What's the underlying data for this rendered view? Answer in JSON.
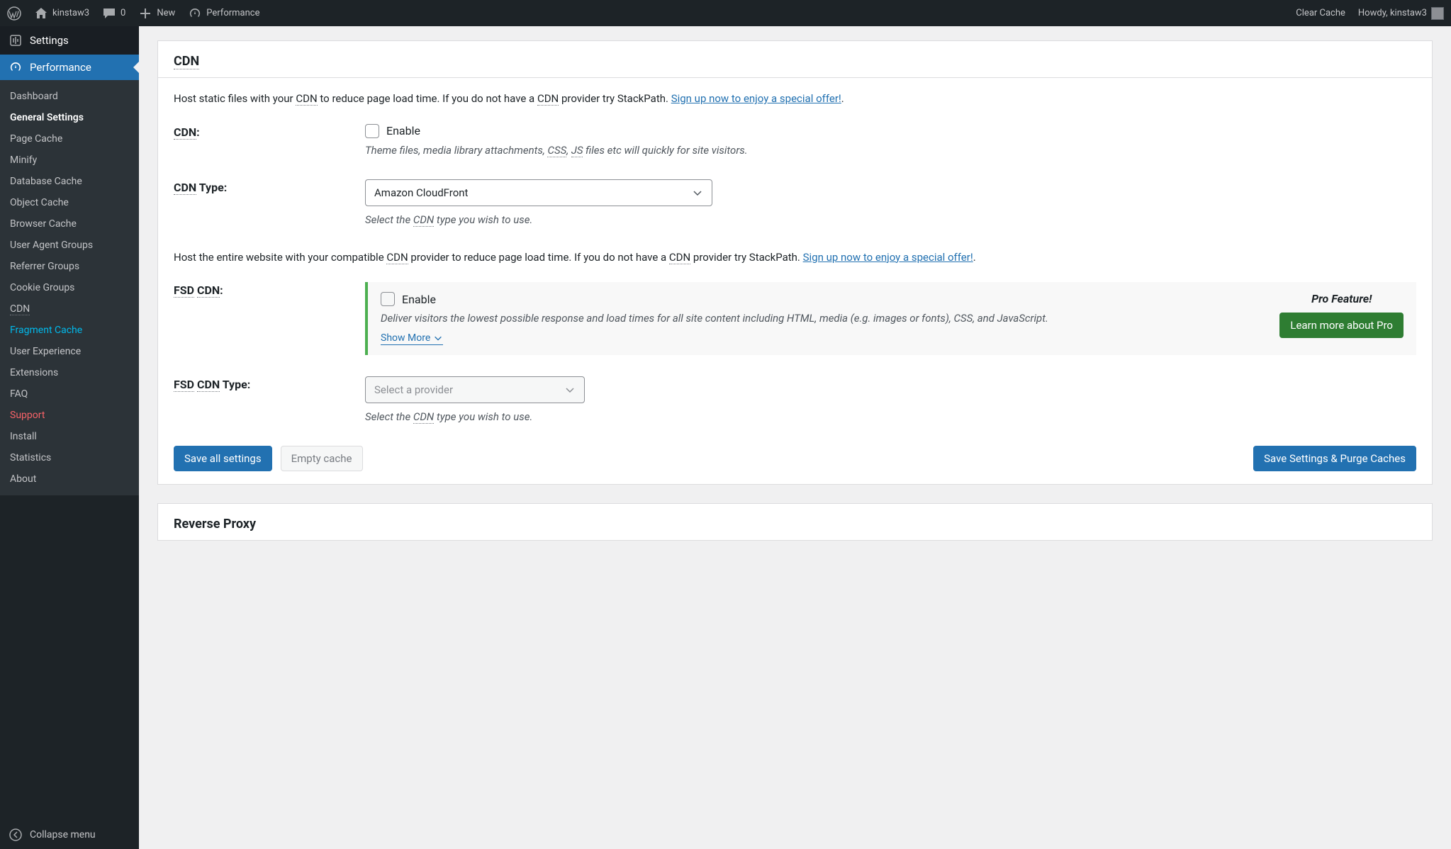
{
  "adminbar": {
    "site_name": "kinstaw3",
    "comment_count": "0",
    "new_label": "New",
    "performance_label": "Performance",
    "clear_cache": "Clear Cache",
    "howdy": "Howdy, kinstaw3"
  },
  "sidebar": {
    "settings_label": "Settings",
    "performance_label": "Performance",
    "collapse_label": "Collapse menu",
    "items": [
      {
        "label": "Dashboard",
        "cls": ""
      },
      {
        "label": "General Settings",
        "cls": "active"
      },
      {
        "label": "Page Cache",
        "cls": ""
      },
      {
        "label": "Minify",
        "cls": ""
      },
      {
        "label": "Database Cache",
        "cls": ""
      },
      {
        "label": "Object Cache",
        "cls": ""
      },
      {
        "label": "Browser Cache",
        "cls": ""
      },
      {
        "label": "User Agent Groups",
        "cls": ""
      },
      {
        "label": "Referrer Groups",
        "cls": ""
      },
      {
        "label": "Cookie Groups",
        "cls": ""
      },
      {
        "label": "CDN",
        "cls": "",
        "dotted": true
      },
      {
        "label": "Fragment Cache",
        "cls": "highlight"
      },
      {
        "label": "User Experience",
        "cls": ""
      },
      {
        "label": "Extensions",
        "cls": ""
      },
      {
        "label": "FAQ",
        "cls": ""
      },
      {
        "label": "Support",
        "cls": "red"
      },
      {
        "label": "Install",
        "cls": ""
      },
      {
        "label": "Statistics",
        "cls": ""
      },
      {
        "label": "About",
        "cls": ""
      }
    ]
  },
  "panel": {
    "title_abbr": "CDN",
    "desc1_a": "Host static files with your ",
    "desc1_b": "CDN",
    "desc1_c": " to reduce page load time. If you do not have a ",
    "desc1_d": "CDN",
    "desc1_e": " provider try StackPath. ",
    "desc1_link": "Sign up now to enjoy a special offer!",
    "desc1_f": ".",
    "cdn_label_a": "CDN",
    "cdn_label_b": ":",
    "enable_label": "Enable",
    "cdn_hint_a": "Theme files, media library attachments, ",
    "cdn_hint_b": "CSS",
    "cdn_hint_c": ", ",
    "cdn_hint_d": "JS",
    "cdn_hint_e": " files etc will quickly for site visitors.",
    "cdn_type_label_a": "CDN",
    "cdn_type_label_b": " Type:",
    "cdn_type_value": "Amazon CloudFront",
    "cdn_type_hint_a": "Select the ",
    "cdn_type_hint_b": "CDN",
    "cdn_type_hint_c": " type you wish to use.",
    "desc2_a": "Host the entire website with your compatible ",
    "desc2_b": "CDN",
    "desc2_c": " provider to reduce page load time. If you do not have a ",
    "desc2_d": "CDN",
    "desc2_e": " provider try StackPath. ",
    "desc2_link": "Sign up now to enjoy a special offer!",
    "desc2_f": ".",
    "fsd_label_a": "FSD",
    "fsd_label_b": " ",
    "fsd_label_c": "CDN",
    "fsd_label_d": ":",
    "fsd_hint": "Deliver visitors the lowest possible response and load times for all site content including HTML, media (e.g. images or fonts), CSS, and JavaScript.",
    "show_more": "Show More",
    "pro_title": "Pro Feature!",
    "pro_button": "Learn more about Pro",
    "fsd_type_label_a": "FSD",
    "fsd_type_label_b": " ",
    "fsd_type_label_c": "CDN",
    "fsd_type_label_d": " Type:",
    "fsd_type_placeholder": "Select a provider",
    "save_all": "Save all settings",
    "empty_cache": "Empty cache",
    "save_purge": "Save Settings & Purge Caches"
  },
  "panel2": {
    "title": "Reverse Proxy"
  }
}
